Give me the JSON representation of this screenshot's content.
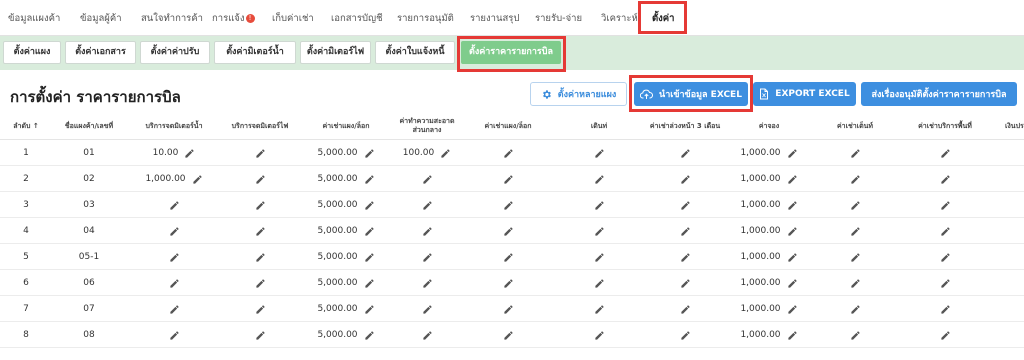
{
  "nav": {
    "items": [
      "ข้อมูลแผงค้า",
      "ข้อมูลผู้ค้า",
      "สนใจทำการค้า",
      "การแจ้ง",
      "เก็บค่าเช่า",
      "เอกสารบัญชี",
      "รายการอนุมัติ",
      "รายงานสรุป",
      "รายรับ-จ่าย",
      "วิเคราะห์",
      "ตั้งค่า"
    ],
    "badge": "!",
    "active": "ตั้งค่า"
  },
  "subtabs": [
    "ตั้งค่าแผง",
    "ตั้งค่าเอกสาร",
    "ตั้งค่าค่าปรับ",
    "ตั้งค่ามิเตอร์น้ำ",
    "ตั้งค่ามิเตอร์ไฟ",
    "ตั้งค่าใบแจ้งหนี้",
    "ตั้งค่าราคารายการบิล"
  ],
  "page_title": "การตั้งค่า ราคารายการบิล",
  "buttons": {
    "multi_settings": "ตั้งค่าหลายแผง",
    "import_excel": "นำเข้าข้อมูล EXCEL",
    "export_excel": "EXPORT EXCEL",
    "send_approval": "ส่งเรื่องอนุมัติตั้งค่าราคารายการบิล"
  },
  "table": {
    "headers": [
      "ลำดับ",
      "ชื่อแผงค้า/เลขที่",
      "บริการจดมิเตอร์น้ำ",
      "บริการจดมิเตอร์ไฟ",
      "ค่าเช่าแผง/ล็อก",
      "ค่าทำความสะอาดส่วนกลาง",
      "ค่าเช่าแผง/ล็อก",
      "เดินท่",
      "ค่าเช่าล่วงหน้า 3 เดือน",
      "ค่าจอง",
      "ค่าเช่าเต็นท์",
      "ค่าเช่าบริการพื้นที่",
      "เงินประ"
    ],
    "sort_arrow": "↑",
    "rows": [
      {
        "no": "1",
        "name": "01",
        "water": "10.00",
        "electric": "",
        "rent": "5,000.00",
        "cleaning": "100.00",
        "rent2": "",
        "walk": "",
        "advance": "",
        "booking": "1,000.00",
        "tent": "",
        "area": ""
      },
      {
        "no": "2",
        "name": "02",
        "water": "1,000.00",
        "electric": "",
        "rent": "5,000.00",
        "cleaning": "",
        "rent2": "",
        "walk": "",
        "advance": "",
        "booking": "1,000.00",
        "tent": "",
        "area": ""
      },
      {
        "no": "3",
        "name": "03",
        "water": "",
        "electric": "",
        "rent": "5,000.00",
        "cleaning": "",
        "rent2": "",
        "walk": "",
        "advance": "",
        "booking": "1,000.00",
        "tent": "",
        "area": ""
      },
      {
        "no": "4",
        "name": "04",
        "water": "",
        "electric": "",
        "rent": "5,000.00",
        "cleaning": "",
        "rent2": "",
        "walk": "",
        "advance": "",
        "booking": "1,000.00",
        "tent": "",
        "area": ""
      },
      {
        "no": "5",
        "name": "05-1",
        "water": "",
        "electric": "",
        "rent": "5,000.00",
        "cleaning": "",
        "rent2": "",
        "walk": "",
        "advance": "",
        "booking": "1,000.00",
        "tent": "",
        "area": ""
      },
      {
        "no": "6",
        "name": "06",
        "water": "",
        "electric": "",
        "rent": "5,000.00",
        "cleaning": "",
        "rent2": "",
        "walk": "",
        "advance": "",
        "booking": "1,000.00",
        "tent": "",
        "area": ""
      },
      {
        "no": "7",
        "name": "07",
        "water": "",
        "electric": "",
        "rent": "5,000.00",
        "cleaning": "",
        "rent2": "",
        "walk": "",
        "advance": "",
        "booking": "1,000.00",
        "tent": "",
        "area": ""
      },
      {
        "no": "8",
        "name": "08",
        "water": "",
        "electric": "",
        "rent": "5,000.00",
        "cleaning": "",
        "rent2": "",
        "walk": "",
        "advance": "",
        "booking": "1,000.00",
        "tent": "",
        "area": ""
      }
    ]
  },
  "colors": {
    "accent": "#3d8fe0",
    "active_tab": "#7fcc8c",
    "subbar_bg": "#d9ecdc",
    "highlight": "#e53935"
  }
}
